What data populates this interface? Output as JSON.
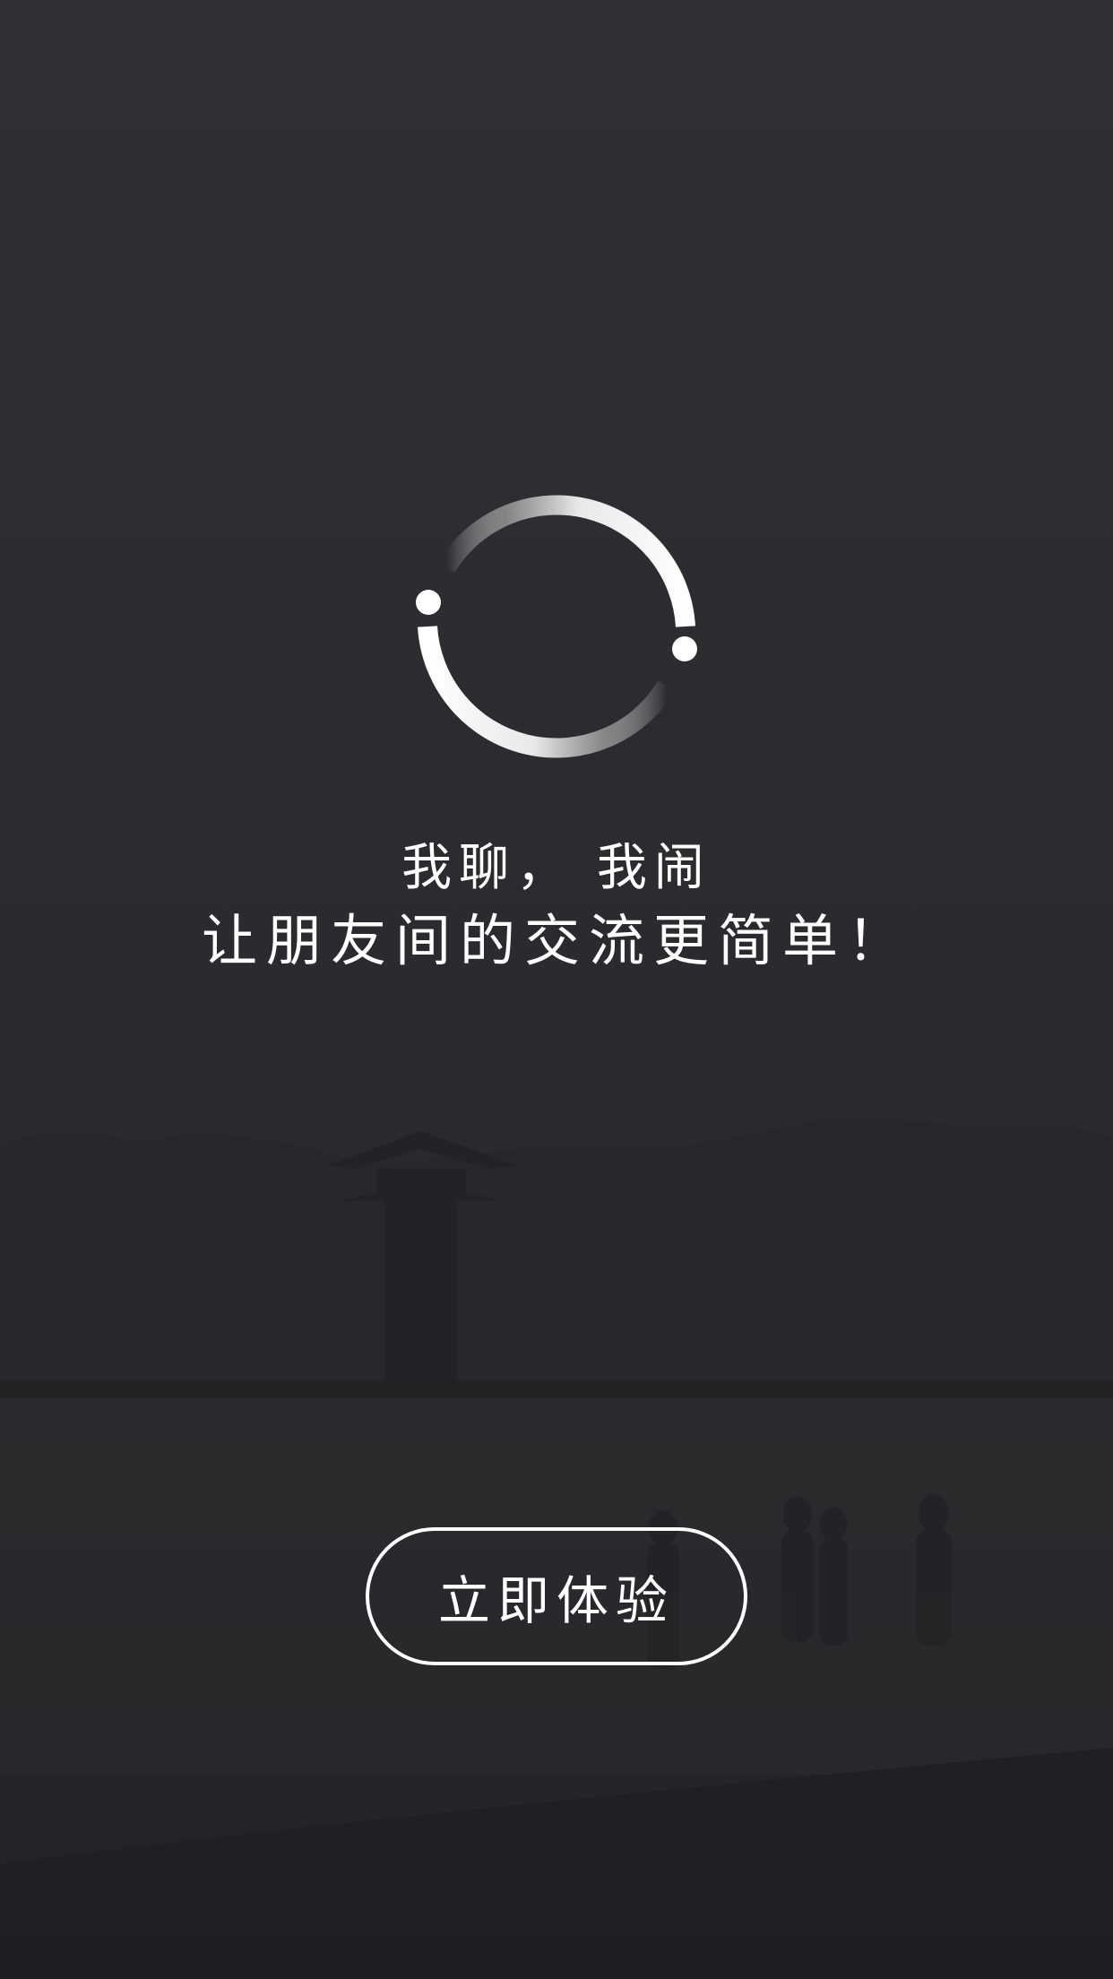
{
  "logo": {
    "icon": "chat-ring-logo-icon",
    "color": "#ffffff"
  },
  "slogan": {
    "line1": "我聊，  我闹",
    "line2": "让朋友间的交流更简单！"
  },
  "start_button": {
    "label": "立即体验"
  },
  "colors": {
    "background": "#2d2d31",
    "text": "#ffffff"
  }
}
